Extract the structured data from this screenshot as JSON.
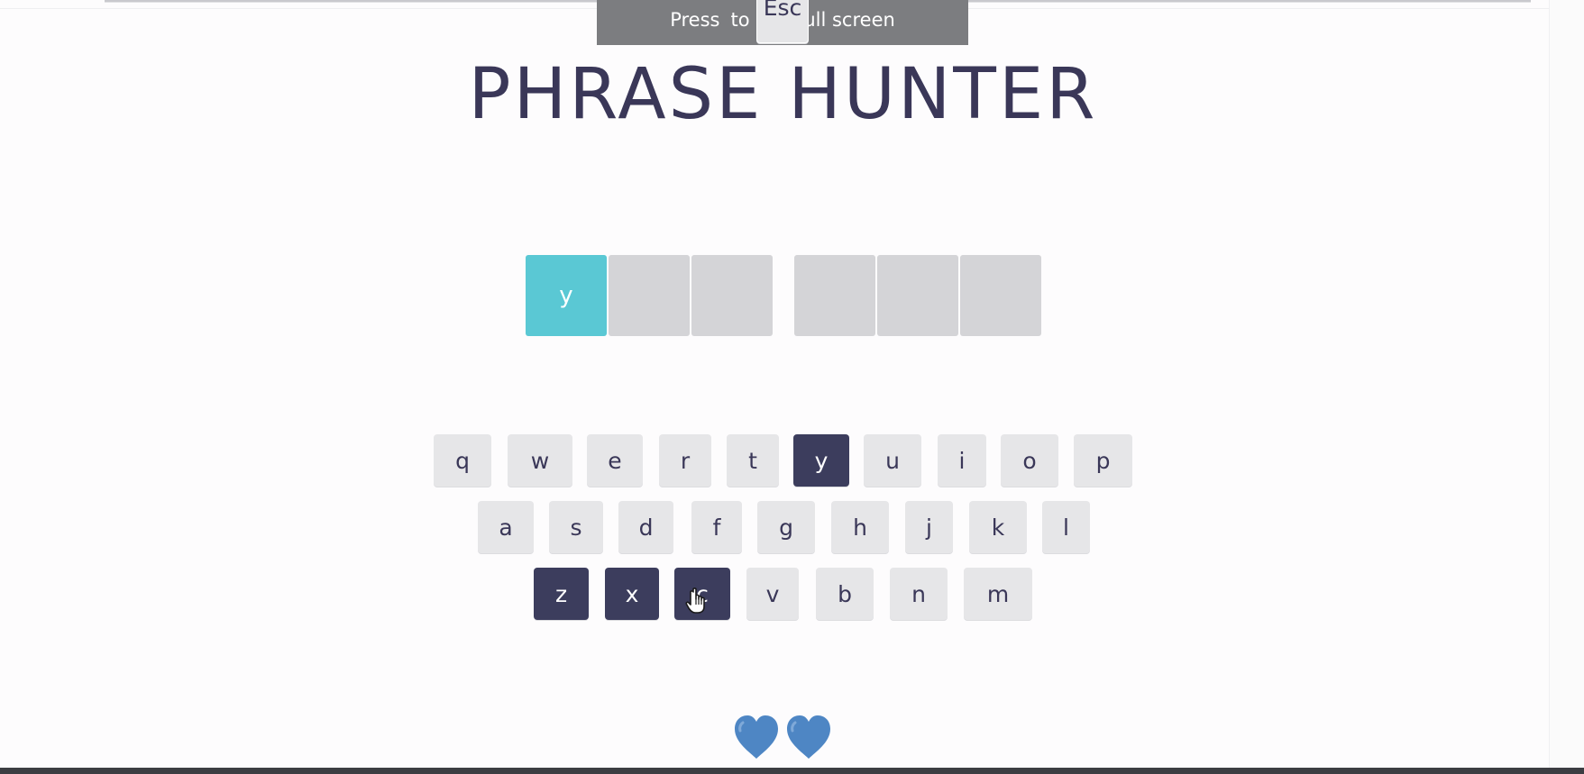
{
  "fullscreen_notice": {
    "before": "Press",
    "key": "Esc",
    "after": "to exit full screen"
  },
  "title": "PHRASE HUNTER",
  "phrase": {
    "words": [
      [
        {
          "letter": "y",
          "shown": true
        },
        {
          "letter": "",
          "shown": false
        },
        {
          "letter": "",
          "shown": false
        }
      ],
      [
        {
          "letter": "",
          "shown": false
        },
        {
          "letter": "",
          "shown": false
        },
        {
          "letter": "",
          "shown": false
        }
      ]
    ]
  },
  "keyboard": {
    "rows": [
      [
        {
          "key": "q",
          "chosen": false
        },
        {
          "key": "w",
          "chosen": false
        },
        {
          "key": "e",
          "chosen": false
        },
        {
          "key": "r",
          "chosen": false
        },
        {
          "key": "t",
          "chosen": false
        },
        {
          "key": "y",
          "chosen": true
        },
        {
          "key": "u",
          "chosen": false
        },
        {
          "key": "i",
          "chosen": false
        },
        {
          "key": "o",
          "chosen": false
        },
        {
          "key": "p",
          "chosen": false
        }
      ],
      [
        {
          "key": "a",
          "chosen": false
        },
        {
          "key": "s",
          "chosen": false
        },
        {
          "key": "d",
          "chosen": false
        },
        {
          "key": "f",
          "chosen": false
        },
        {
          "key": "g",
          "chosen": false
        },
        {
          "key": "h",
          "chosen": false
        },
        {
          "key": "j",
          "chosen": false
        },
        {
          "key": "k",
          "chosen": false
        },
        {
          "key": "l",
          "chosen": false
        }
      ],
      [
        {
          "key": "z",
          "chosen": true
        },
        {
          "key": "x",
          "chosen": true
        },
        {
          "key": "c",
          "chosen": true
        },
        {
          "key": "v",
          "chosen": false
        },
        {
          "key": "b",
          "chosen": false
        },
        {
          "key": "n",
          "chosen": false
        },
        {
          "key": "m",
          "chosen": false
        }
      ]
    ]
  },
  "lives": {
    "remaining": 2,
    "icon": "heart-icon",
    "color": "#4e86c4"
  },
  "colors": {
    "title": "#3a3758",
    "tile_hidden": "#d4d4d7",
    "tile_shown": "#5ac8d4",
    "key_default": "#e6e6e8",
    "key_chosen": "#3c3d5d"
  }
}
